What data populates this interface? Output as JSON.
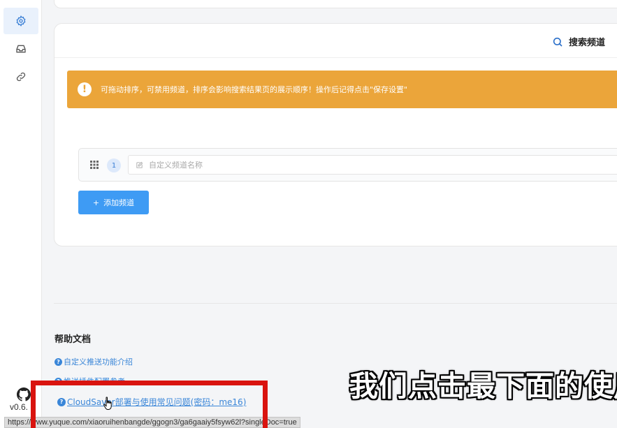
{
  "sidebar": {
    "items": [
      {
        "icon": "gear-icon",
        "active": true
      },
      {
        "icon": "inbox-icon",
        "active": false
      },
      {
        "icon": "link-icon",
        "active": false
      }
    ],
    "github_icon": "github-icon",
    "version": "v0.6."
  },
  "card": {
    "search_title": "搜索频道",
    "alert_text": "可拖动排序，可禁用频道，排序会影响搜索结果页的展示顺序！操作后记得点击\"保存设置\"",
    "alert_icon": "!",
    "channel_row": {
      "index": "1",
      "name_placeholder": "自定义频道名称"
    },
    "add_button": "添加频道",
    "add_button_icon": "+"
  },
  "help": {
    "title": "帮助文档",
    "links": [
      {
        "text": "自定义推送功能介绍"
      },
      {
        "text": "推送插件配置参考"
      },
      {
        "text": "CloudSaver部署与使用常见问题(密码：me16)"
      }
    ]
  },
  "status_url": "https://www.yuque.com/xiaoruihenbangde/ggogn3/ga6gaaiy5fsyw62l?singleDoc=true",
  "overlay": {
    "subtitle": "我们点击最下面的使用"
  },
  "colors": {
    "accent": "#3e9bf4",
    "alert": "#eba53a",
    "highlight_box": "#d9140f"
  }
}
